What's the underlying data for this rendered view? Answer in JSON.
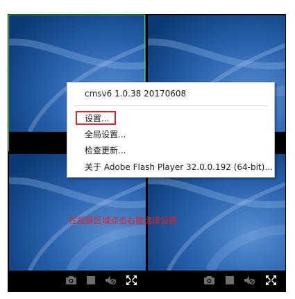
{
  "context_menu": {
    "header": "cmsv6 1.0.38 20170608",
    "items": [
      {
        "label": "设置..."
      },
      {
        "label": "全局设置..."
      },
      {
        "label": "检查更新..."
      },
      {
        "label": "关于 Adobe Flash Player 32.0.0.192 (64-bit)..."
      }
    ]
  },
  "annotation": {
    "text": "在视屏区域点击右键选择设置"
  },
  "toolbar_icons": [
    "camera-icon",
    "record-stop-icon",
    "mute-icon",
    "fullscreen-icon"
  ],
  "colors": {
    "selected_border": "#3fd23a",
    "highlight": "#d9252b",
    "annotation": "#e0212a",
    "pane_background": "#0f3e78"
  }
}
